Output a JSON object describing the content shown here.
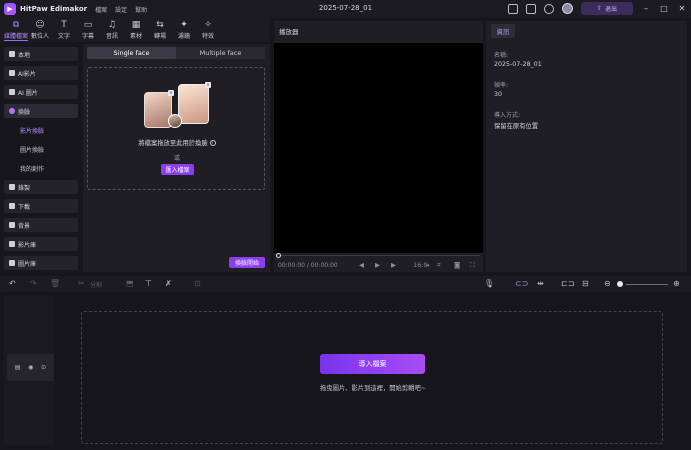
{
  "app": {
    "name": "HitPaw Edimakor",
    "menu": [
      "檔案",
      "設定",
      "幫助"
    ],
    "project_title": "2025-07-28_01",
    "login_label": "退出"
  },
  "toolbar": {
    "items": [
      {
        "label": "媒體檔案",
        "icon": "media-icon",
        "glyph": "⧉",
        "active": true
      },
      {
        "label": "數位人",
        "icon": "avatar-icon",
        "glyph": "☺",
        "active": false
      },
      {
        "label": "文字",
        "icon": "text-icon",
        "glyph": "T",
        "active": false
      },
      {
        "label": "字幕",
        "icon": "subtitle-icon",
        "glyph": "▭",
        "active": false
      },
      {
        "label": "音訊",
        "icon": "audio-icon",
        "glyph": "♫",
        "active": false
      },
      {
        "label": "素材",
        "icon": "assets-icon",
        "glyph": "▦",
        "active": false
      },
      {
        "label": "轉場",
        "icon": "transition-icon",
        "glyph": "⇆",
        "active": false
      },
      {
        "label": "濾鏡",
        "icon": "filter-icon",
        "glyph": "✦",
        "active": false
      },
      {
        "label": "特效",
        "icon": "effects-icon",
        "glyph": "✧",
        "active": false
      }
    ]
  },
  "sidebar": {
    "items": [
      {
        "label": "本地",
        "type": "item"
      },
      {
        "label": "AI影片",
        "type": "item"
      },
      {
        "label": "AI 圖片",
        "type": "item"
      },
      {
        "label": "換臉",
        "type": "item",
        "active": true
      },
      {
        "label": "影片換臉",
        "type": "sub",
        "active": true
      },
      {
        "label": "圖片換臉",
        "type": "sub"
      },
      {
        "label": "我的創作",
        "type": "sub"
      },
      {
        "label": "錄製",
        "type": "item"
      },
      {
        "label": "下載",
        "type": "item"
      },
      {
        "label": "背景",
        "type": "item"
      },
      {
        "label": "影片庫",
        "type": "item"
      },
      {
        "label": "圖片庫",
        "type": "item"
      }
    ]
  },
  "faceswap": {
    "tabs": [
      "Single face",
      "Multiple face"
    ],
    "active_tab": 0,
    "drop_text": "將檔案拖放至此用於換臉",
    "or_text": "或",
    "import_label": "匯入檔案",
    "start_label": "換臉開始"
  },
  "player": {
    "title": "播放器",
    "time": "00:00:00 / 00:00:00",
    "aspect": "16:9",
    "progress": 0
  },
  "info": {
    "tab": "資訊",
    "fields": [
      {
        "label": "名稱:",
        "value": "2025-07-28_01"
      },
      {
        "label": "幀率:",
        "value": "30"
      },
      {
        "label": "導入方式:",
        "value": "保留在原有位置"
      }
    ]
  },
  "timeline": {
    "split_label": "分割",
    "import_media_label": "導入檔案",
    "hint": "拖曳圖片、影片到這裡，開始剪輯吧~"
  },
  "colors": {
    "accent": "#8d3df0",
    "accent_text": "#b88dff",
    "background": "#17161c",
    "panel": "#1f1e25"
  }
}
